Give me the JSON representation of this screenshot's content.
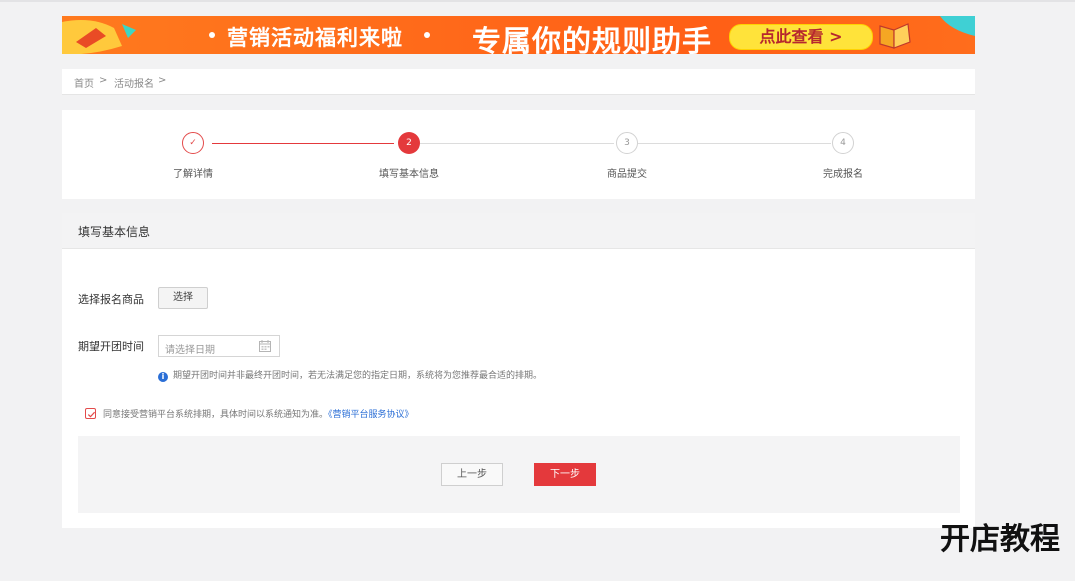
{
  "banner": {
    "promo_text": "营销活动福利来啦",
    "headline": "专属你的规则助手",
    "cta_label": "点此查看 >"
  },
  "breadcrumb": {
    "items": [
      "首页",
      "活动报名"
    ],
    "separator": ">"
  },
  "steps": {
    "items": [
      {
        "label": "了解详情",
        "number": "✓",
        "state": "done"
      },
      {
        "label": "填写基本信息",
        "number": "2",
        "state": "active"
      },
      {
        "label": "商品提交",
        "number": "3",
        "state": "todo"
      },
      {
        "label": "完成报名",
        "number": "4",
        "state": "todo"
      }
    ]
  },
  "form": {
    "title": "填写基本信息",
    "product_label": "选择报名商品",
    "select_button": "选择",
    "date_label": "期望开团时间",
    "date_placeholder": "请选择日期",
    "date_hint": "期望开团时间并非最终开团时间，若无法满足您的指定日期，系统将为您推荐最合适的排期。",
    "info_icon": "i",
    "agree_text": "同意接受营销平台系统排期，具体时间以系统通知为准。",
    "agree_link": "《营销平台服务协议》",
    "prev_button": "上一步",
    "next_button": "下一步"
  },
  "watermark": "开店教程",
  "colors": {
    "accent": "#e4393c",
    "banner": "#ff6a1a",
    "link": "#2a6ed6"
  }
}
